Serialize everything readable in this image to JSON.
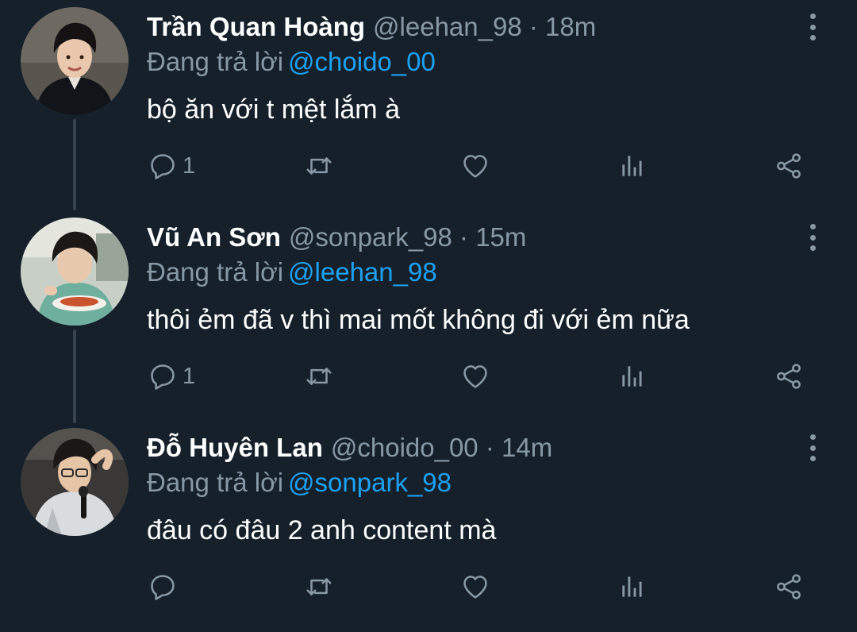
{
  "colors": {
    "background": "#15202b",
    "name": "#ffffff",
    "meta": "#8899a6",
    "mention": "#1da1f2",
    "thread_line": "#38444d"
  },
  "replying_prefix": "Đang trả lời",
  "tweets": [
    {
      "name": "Trần Quan Hoàng",
      "meta": "@leehan_98 · 18m",
      "reply_to": "@choido_00",
      "text": "bộ ăn với t mệt lắm à",
      "reply_count": "1",
      "icons": [
        "reply-icon",
        "retweet-icon",
        "like-icon",
        "analytics-icon",
        "share-icon",
        "more-icon"
      ]
    },
    {
      "name": "Vũ An Sơn",
      "meta": "@sonpark_98 · 15m",
      "reply_to": "@leehan_98",
      "text": "thôi ẻm đã v thì mai mốt không đi với ẻm nữa",
      "reply_count": "1",
      "icons": [
        "reply-icon",
        "retweet-icon",
        "like-icon",
        "analytics-icon",
        "share-icon",
        "more-icon"
      ]
    },
    {
      "name": "Đỗ Huyên Lan",
      "meta": "@choido_00 · 14m",
      "reply_to": "@sonpark_98",
      "text": "đâu có đâu 2 anh content mà",
      "reply_count": "",
      "icons": [
        "reply-icon",
        "retweet-icon",
        "like-icon",
        "analytics-icon",
        "share-icon",
        "more-icon"
      ]
    }
  ]
}
